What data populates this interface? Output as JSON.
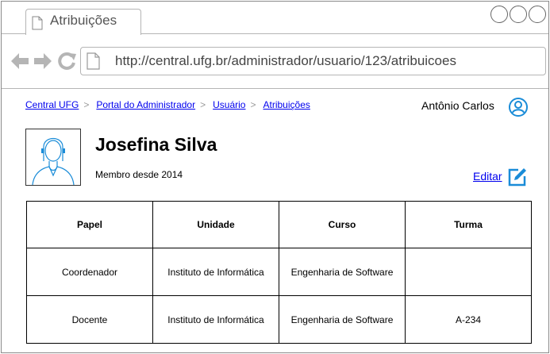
{
  "browser": {
    "tab_title": "Atribuições",
    "url": "http://central.ufg.br/administrador/usuario/123/atribuicoes"
  },
  "breadcrumb": {
    "items": [
      "Central UFG",
      "Portal do Administrador",
      "Usuário",
      "Atribuições"
    ],
    "separator": ">"
  },
  "user_menu": {
    "name": "Antônio Carlos"
  },
  "profile": {
    "name": "Josefina Silva",
    "member_since": "Membro desde 2014",
    "edit_label": "Editar"
  },
  "roles_table": {
    "headers": [
      "Papel",
      "Unidade",
      "Curso",
      "Turma"
    ],
    "rows": [
      [
        "Coordenador",
        "Instituto de Informática",
        "Engenharia de Software",
        ""
      ],
      [
        "Docente",
        "Instituto de Informática",
        "Engenharia de Software",
        "A-234"
      ]
    ]
  },
  "colors": {
    "link": "#0000ee",
    "icon_accent": "#1a8cd8",
    "nav_icon": "#b5b5b5"
  }
}
